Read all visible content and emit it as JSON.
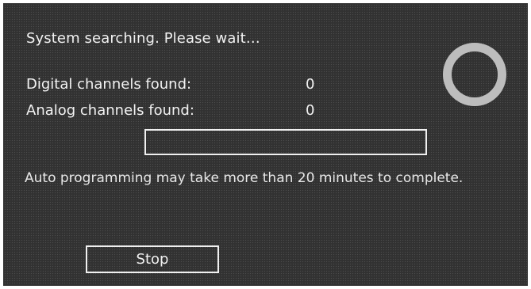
{
  "dialog": {
    "status_text": "System searching. Please wait…",
    "digital": {
      "label": "Digital channels found:",
      "value": "0"
    },
    "analog": {
      "label": "Analog channels found:",
      "value": "0"
    },
    "progress_fraction": 0,
    "note": "Auto programming may take more than 20 minutes to complete.",
    "stop_label": "Stop",
    "spinner_icon": "loading-ring-icon"
  },
  "colors": {
    "background": "#1a1a1a",
    "text": "#f2f2f2",
    "spinner": "#bdbdbd"
  }
}
